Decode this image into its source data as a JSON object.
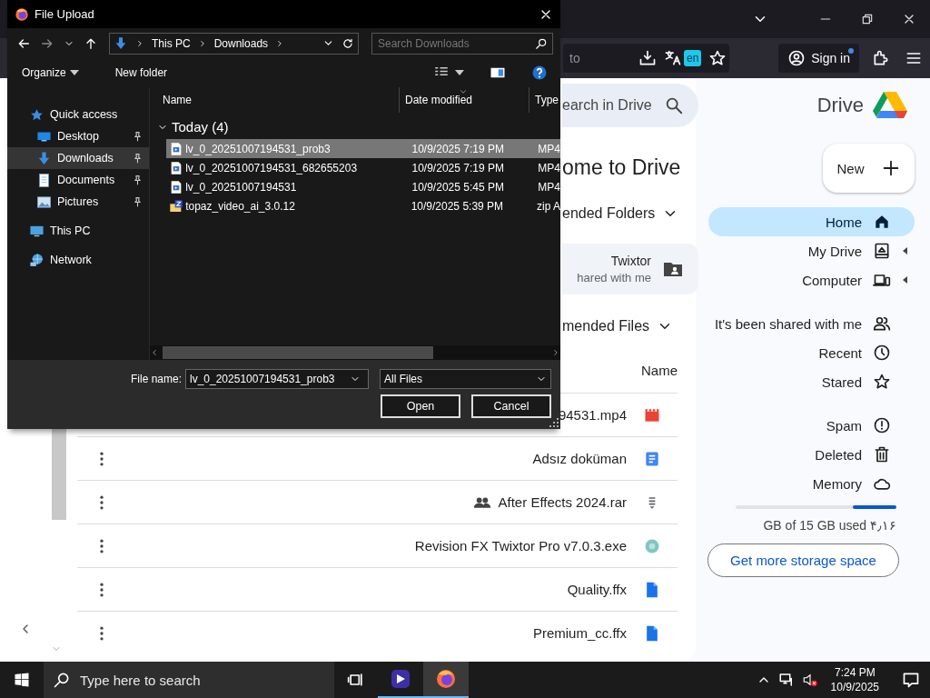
{
  "browser": {
    "url_fragment": "to",
    "translate_badge": "en",
    "sign_in": "Sign in"
  },
  "dialog": {
    "title": "File Upload",
    "path": [
      "This PC",
      "Downloads"
    ],
    "search_placeholder": "Search Downloads",
    "organize": "Organize",
    "new_folder": "New folder",
    "nav": [
      {
        "label": "Quick access",
        "pinned": false,
        "selected": false,
        "children": [
          {
            "label": "Desktop",
            "pinned": true,
            "selected": false
          },
          {
            "label": "Downloads",
            "pinned": true,
            "selected": true
          },
          {
            "label": "Documents",
            "pinned": true,
            "selected": false
          },
          {
            "label": "Pictures",
            "pinned": true,
            "selected": false
          }
        ]
      },
      {
        "label": "This PC",
        "pinned": false,
        "selected": false
      },
      {
        "label": "Network",
        "pinned": false,
        "selected": false
      }
    ],
    "columns": [
      "Name",
      "Date modified",
      "Type"
    ],
    "group": "Today (4)",
    "files": [
      {
        "name": "lv_0_20251007194531_prob3",
        "date": "10/9/2025 7:19 PM",
        "type": "MP4",
        "kind": "video",
        "selected": true
      },
      {
        "name": "lv_0_20251007194531_682655203",
        "date": "10/9/2025 7:19 PM",
        "type": "MP4",
        "kind": "video",
        "selected": false
      },
      {
        "name": "lv_0_20251007194531",
        "date": "10/9/2025 5:45 PM",
        "type": "MP4",
        "kind": "video",
        "selected": false
      },
      {
        "name": "topaz_video_ai_3.0.12",
        "date": "10/9/2025 5:39 PM",
        "type": "zip A",
        "kind": "zip",
        "selected": false
      }
    ],
    "file_name_label": "File name:",
    "file_name": "lv_0_20251007194531_prob3",
    "filter": "All Files",
    "buttons": [
      "Open",
      "Cancel"
    ]
  },
  "drive": {
    "search_placeholder": "earch in Drive",
    "welcome": "ome to Drive",
    "folders_heading": "ended Folders",
    "folder": {
      "name": "Twixtor",
      "subtitle": "hared with me"
    },
    "files_heading": "mended Files",
    "name_column": "Name",
    "cut_row": {
      "name": "94531.mp4",
      "kind": "video"
    },
    "files": [
      {
        "name": "Adsız doküman",
        "kind": "doc",
        "shared": false
      },
      {
        "name": "After Effects 2024.rar",
        "kind": "archive",
        "shared": true
      },
      {
        "name": "Revision FX Twixtor Pro v7.0.3.exe",
        "kind": "app",
        "shared": false
      },
      {
        "name": "Quality.ffx",
        "kind": "file",
        "shared": false
      },
      {
        "name": "Premium_cc.ffx",
        "kind": "file",
        "shared": false
      }
    ],
    "brand": "Drive",
    "new_button": "New",
    "nav_groups": [
      [
        {
          "label": "Home",
          "selected": true,
          "expandable": false
        },
        {
          "label": "My Drive",
          "selected": false,
          "expandable": true
        },
        {
          "label": "Computer",
          "selected": false,
          "expandable": true
        }
      ],
      [
        {
          "label": "It's been shared with me",
          "selected": false,
          "expandable": false
        },
        {
          "label": "Recent",
          "selected": false,
          "expandable": false
        },
        {
          "label": "Stared",
          "selected": false,
          "expandable": false
        }
      ],
      [
        {
          "label": "Spam",
          "selected": false,
          "expandable": false
        },
        {
          "label": "Deleted",
          "selected": false,
          "expandable": false
        },
        {
          "label": "Memory",
          "selected": false,
          "expandable": false
        }
      ]
    ],
    "storage": {
      "level": 0.27,
      "text": "GB of 15 GB used ۴٫۱۶"
    },
    "storage_button": "Get more storage space"
  },
  "taskbar": {
    "search_placeholder": "Type here to search",
    "apps": [
      {
        "kind": "player",
        "running": true,
        "active": false
      },
      {
        "kind": "firefox",
        "running": true,
        "active": true
      }
    ],
    "time": "7:24 PM",
    "date": "10/9/2025"
  }
}
